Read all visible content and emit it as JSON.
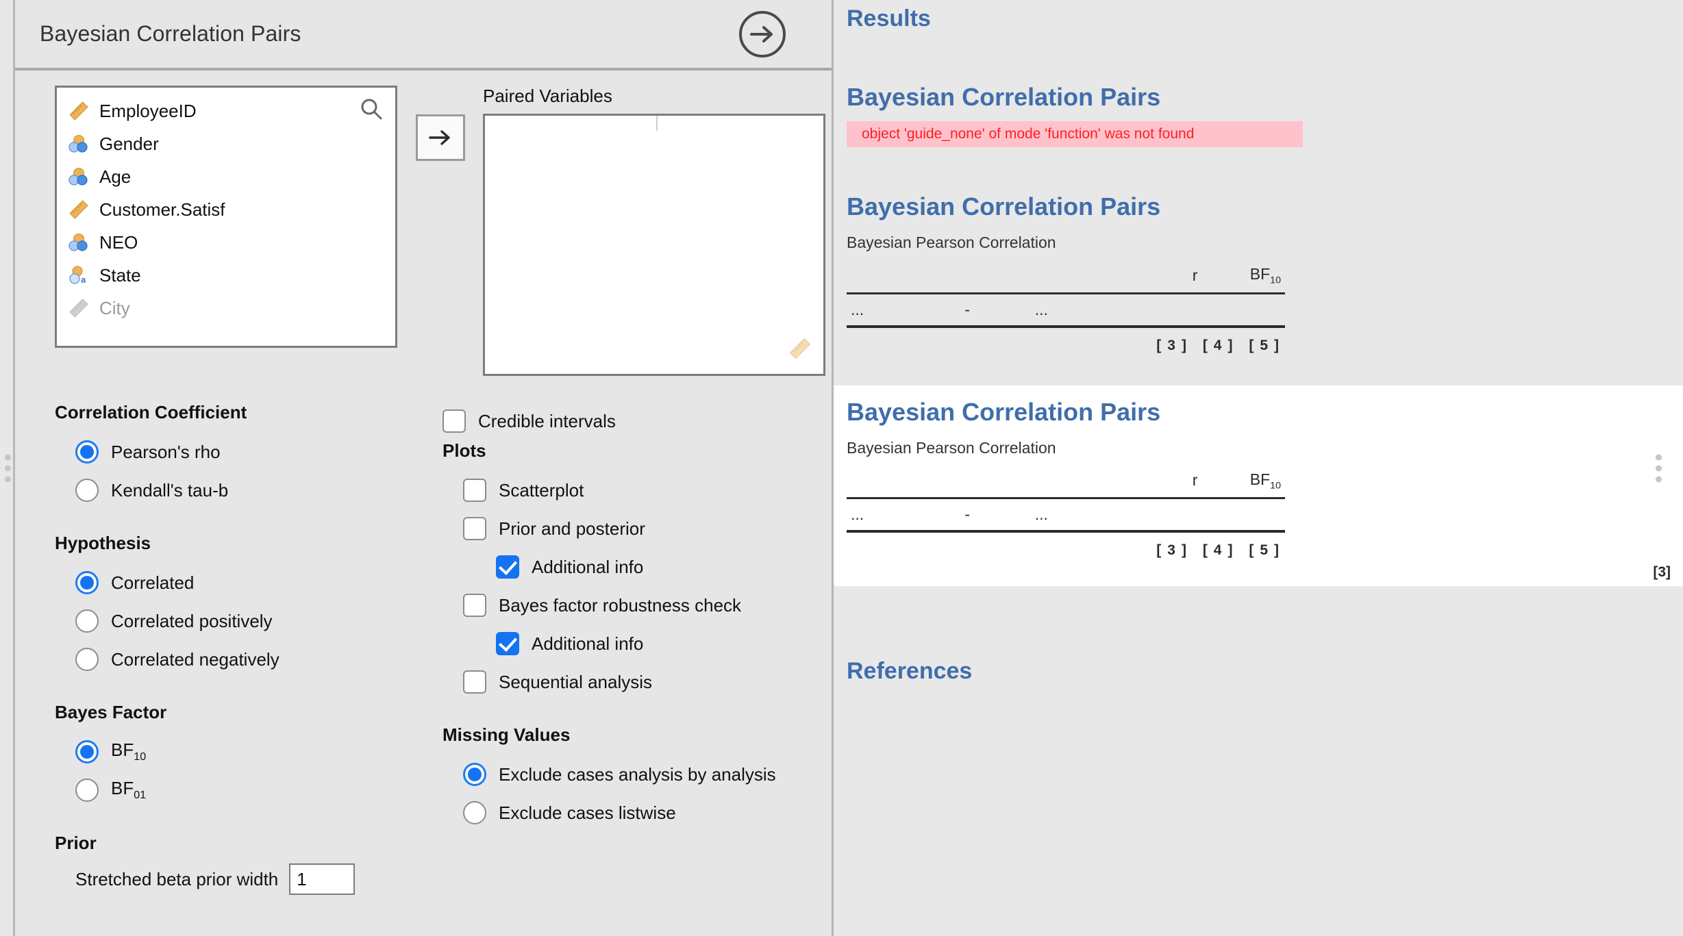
{
  "options_panel": {
    "title": "Bayesian Correlation Pairs",
    "collapse_icon": "arrow-right-circle-icon",
    "variables_list": {
      "search_icon": "search-icon",
      "items": [
        {
          "name": "EmployeeID",
          "type": "scale",
          "icon": "ruler-icon",
          "disabled": false
        },
        {
          "name": "Gender",
          "type": "nominal",
          "icon": "nominal-circles-icon",
          "disabled": false
        },
        {
          "name": "Age",
          "type": "nominal",
          "icon": "nominal-circles-icon",
          "disabled": false
        },
        {
          "name": "Customer.Satisf",
          "type": "scale",
          "icon": "ruler-icon",
          "disabled": false
        },
        {
          "name": "NEO",
          "type": "nominal",
          "icon": "nominal-circles-icon",
          "disabled": false
        },
        {
          "name": "State",
          "type": "nominal-text",
          "icon": "nominal-text-icon",
          "disabled": false
        },
        {
          "name": "City",
          "type": "scale",
          "icon": "ruler-icon",
          "disabled": true
        }
      ]
    },
    "transfer_button": {
      "icon": "arrow-right-icon"
    },
    "paired_variables": {
      "label": "Paired Variables",
      "items": [],
      "drop_hint_icon": "ruler-icon"
    },
    "correlation_coefficient": {
      "title": "Correlation Coefficient",
      "options": [
        {
          "label": "Pearson's rho",
          "selected": true
        },
        {
          "label": "Kendall's tau-b",
          "selected": false
        }
      ]
    },
    "hypothesis": {
      "title": "Hypothesis",
      "options": [
        {
          "label": "Correlated",
          "selected": true
        },
        {
          "label": "Correlated positively",
          "selected": false
        },
        {
          "label": "Correlated negatively",
          "selected": false
        }
      ]
    },
    "bayes_factor": {
      "title": "Bayes Factor",
      "options": [
        {
          "label": "BF",
          "sub": "10",
          "selected": true
        },
        {
          "label": "BF",
          "sub": "01",
          "selected": false
        }
      ]
    },
    "prior": {
      "title": "Prior",
      "field_label": "Stretched beta prior width",
      "field_value": "1"
    },
    "credible_intervals": {
      "label": "Credible intervals",
      "checked": false
    },
    "plots": {
      "title": "Plots",
      "options": [
        {
          "label": "Scatterplot",
          "checked": false,
          "indent": false
        },
        {
          "label": "Prior and posterior",
          "checked": false,
          "indent": false
        },
        {
          "label": "Additional info",
          "checked": true,
          "indent": true
        },
        {
          "label": "Bayes factor robustness check",
          "checked": false,
          "indent": false
        },
        {
          "label": "Additional info",
          "checked": true,
          "indent": true
        },
        {
          "label": "Sequential analysis",
          "checked": false,
          "indent": false
        }
      ]
    },
    "missing_values": {
      "title": "Missing Values",
      "options": [
        {
          "label": "Exclude cases analysis by analysis",
          "selected": true
        },
        {
          "label": "Exclude cases listwise",
          "selected": false
        }
      ]
    }
  },
  "results_panel": {
    "heading": "Results",
    "block1": {
      "heading": "Bayesian Correlation Pairs",
      "error_message": "object 'guide_none' of mode 'function' was not found"
    },
    "block2": {
      "heading": "Bayesian Correlation Pairs",
      "table": {
        "title": "Bayesian Pearson Correlation",
        "columns": [
          "",
          "",
          "",
          "r",
          "BF10"
        ],
        "col_r": "r",
        "col_bf_base": "BF",
        "col_bf_sub": "10",
        "rows": [
          [
            "...",
            "-",
            "...",
            "",
            ""
          ]
        ],
        "footnote_marks": [
          "[3]",
          "[4]",
          "[5]"
        ]
      }
    },
    "block3": {
      "heading": "Bayesian Correlation Pairs",
      "table": {
        "title": "Bayesian Pearson Correlation",
        "col_r": "r",
        "col_bf_base": "BF",
        "col_bf_sub": "10",
        "rows": [
          [
            "...",
            "-",
            "...",
            "",
            ""
          ]
        ],
        "footnote_marks": [
          "[3]",
          "[4]",
          "[5]"
        ]
      },
      "tail_mark": "[3]"
    },
    "references_heading": "References"
  },
  "colors": {
    "accent_blue": "#3f6eab",
    "control_blue": "#1473f0",
    "error_text": "#ff1f1f",
    "error_bg": "#ffc2cc",
    "panel_bg": "#e6e6e6"
  }
}
